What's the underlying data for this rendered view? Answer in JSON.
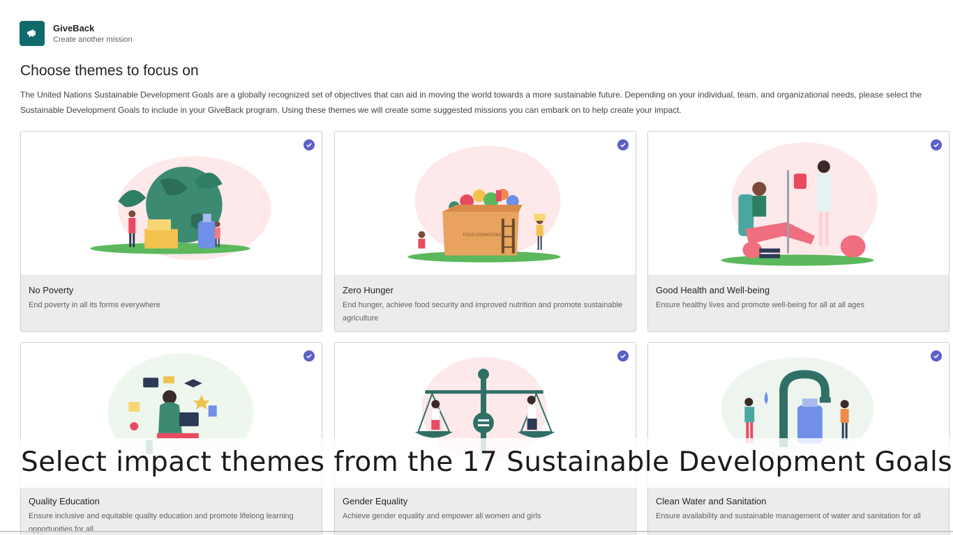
{
  "app": {
    "name": "GiveBack",
    "subtitle": "Create another mission",
    "logo_icon": "megaphone-icon",
    "brand_color": "#0f6b6b"
  },
  "page": {
    "title": "Choose themes to focus on",
    "description": "The United Nations Sustainable Development Goals are a globally recognized set of objectives that can aid in moving the world towards a more sustainable future. Depending on your individual, team, and organizational needs, please select the Sustainable Development Goals to include in your GiveBack program. Using these themes we will create some suggested missions you can embark on to help create your impact."
  },
  "accent_color": "#5b5fc7",
  "themes": [
    {
      "title": "No Poverty",
      "description": "End poverty in all its forms everywhere",
      "selected": true,
      "illustration": "globe-charity-illustration"
    },
    {
      "title": "Zero Hunger",
      "description": "End hunger, achieve food security and improved nutrition and promote sustainable agriculture",
      "selected": true,
      "illustration": "food-donation-box-illustration",
      "box_label": "FOOD DONATIONS"
    },
    {
      "title": "Good Health and Well-being",
      "description": "Ensure healthy lives and promote well-being for all at all ages",
      "selected": true,
      "illustration": "blood-donation-illustration"
    },
    {
      "title": "Quality Education",
      "description": "Ensure inclusive and equitable quality education and promote lifelong learning opportunities for all",
      "selected": true,
      "illustration": "student-laptop-illustration"
    },
    {
      "title": "Gender Equality",
      "description": "Achieve gender equality and empower all women and girls",
      "selected": true,
      "illustration": "balance-scale-illustration"
    },
    {
      "title": "Clean Water and Sanitation",
      "description": "Ensure availability and sustainable management of water and sanitation for all",
      "selected": true,
      "illustration": "water-tap-illustration"
    }
  ],
  "caption": "Select impact themes from the 17 Sustainable Development Goals"
}
